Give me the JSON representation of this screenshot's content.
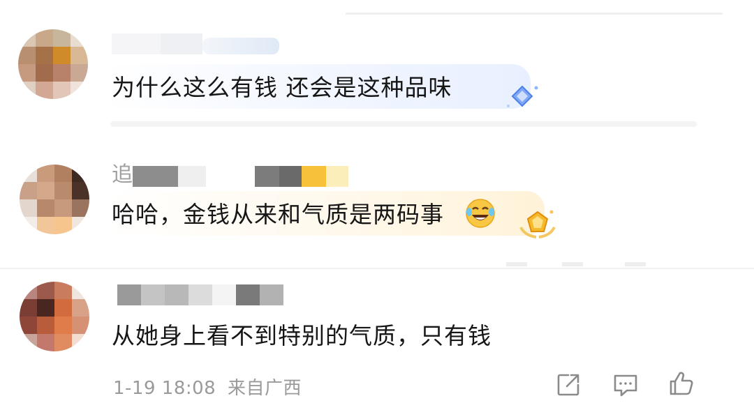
{
  "comments": [
    {
      "username": "",
      "text": "为什么这么有钱 还会是这种品味",
      "badge": "diamond-badge"
    },
    {
      "username": "追",
      "text": "哈哈，金钱从来和气质是两码事",
      "emoji": "laughing-crying-emoji",
      "badge": "gold-shield-badge"
    },
    {
      "username": "",
      "text": "从她身上看不到特别的气质，只有钱"
    }
  ],
  "meta": {
    "date": "1-19 18:08",
    "location": "来自广西"
  },
  "actions": [
    {
      "icon": "share-icon"
    },
    {
      "icon": "comment-icon"
    },
    {
      "icon": "like-icon"
    }
  ],
  "colors": {
    "text": "#161616",
    "meta": "#9a9a9a",
    "bubble_blue": "#eef4ff",
    "bubble_gold": "#fff6e6"
  }
}
